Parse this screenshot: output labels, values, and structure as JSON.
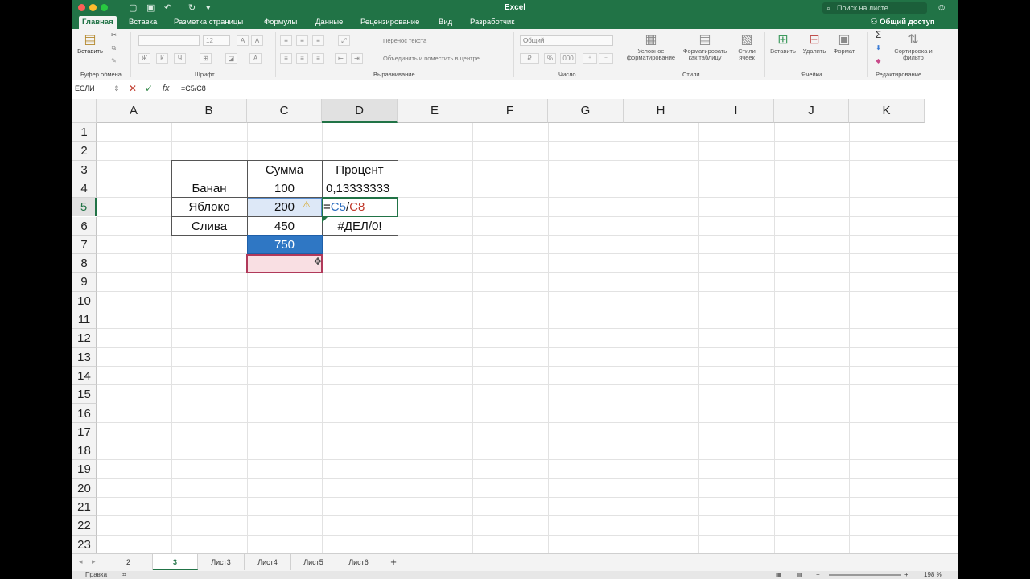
{
  "titlebar": {
    "title": "Excel",
    "search_placeholder": "Поиск на листе"
  },
  "tabs": [
    "Главная",
    "Вставка",
    "Разметка страницы",
    "Формулы",
    "Данные",
    "Рецензирование",
    "Вид",
    "Разработчик"
  ],
  "share_label": "Общий доступ",
  "ribbon": {
    "paste": "Вставить",
    "font_size": "12",
    "font_bold": "Ж",
    "font_italic": "К",
    "font_underline": "Ч",
    "wrap_text": "Перенос текста",
    "merge_center": "Объединить и поместить в центре",
    "number_format": "Общий",
    "cond_format": "Условное форматирование",
    "format_table": "Форматировать как таблицу",
    "cell_styles": "Стили ячеек",
    "insert": "Вставить",
    "delete": "Удалить",
    "format": "Формат",
    "sort_filter": "Сортировка и фильтр",
    "groups": {
      "clipboard": "Буфер обмена",
      "font": "Шрифт",
      "alignment": "Выравнивание",
      "number": "Число",
      "styles": "Стили",
      "cells": "Ячейки",
      "editing": "Редактирование"
    }
  },
  "formula_bar": {
    "name_box": "ЕСЛИ",
    "formula": "=C5/C8"
  },
  "columns": [
    "A",
    "B",
    "C",
    "D",
    "E",
    "F",
    "G",
    "H",
    "I",
    "J",
    "K"
  ],
  "rows": [
    "1",
    "2",
    "3",
    "4",
    "5",
    "6",
    "7",
    "8",
    "9",
    "10",
    "11",
    "12",
    "13",
    "14",
    "15",
    "16",
    "17",
    "18",
    "19",
    "20",
    "21",
    "22",
    "23"
  ],
  "cells": {
    "C3": "Сумма",
    "D3": "Процент",
    "B4": "Банан",
    "C4": "100",
    "D4": "0,13333333",
    "B5": "Яблоко",
    "C5": "200",
    "D5_eq": "=",
    "D5_ref1": "C5",
    "D5_slash": "/",
    "D5_ref2": "C8",
    "B6": "Слива",
    "C6": "450",
    "D6": "#ДЕЛ/0!",
    "C7": "750"
  },
  "sheets": [
    "2",
    "3",
    "Лист3",
    "Лист4",
    "Лист5",
    "Лист6"
  ],
  "active_sheet": "3",
  "status": {
    "mode": "Правка",
    "zoom": "198 %"
  }
}
